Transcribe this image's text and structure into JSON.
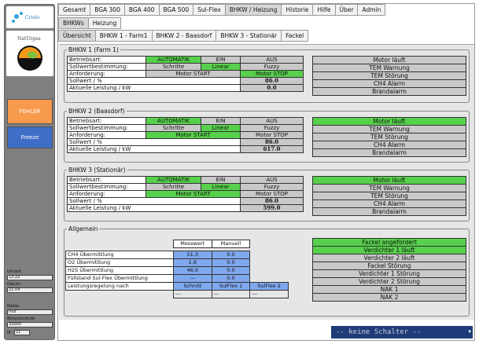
{
  "sidebar": {
    "logo_top": "Cristo",
    "logo_main": "NatUrgas",
    "fehler": "FEHLER",
    "freeze": "Freeze",
    "fields": [
      {
        "label": "Uhrzeit",
        "value": "13:22"
      },
      {
        "label": "Datum",
        "value": "21.04"
      },
      {
        "label": "Name:",
        "value": "mur"
      },
      {
        "label": "Benutzerstufe",
        "value": "32000"
      }
    ],
    "footer_label": "IP",
    "footer_value": "21"
  },
  "tabs_main": [
    "Gesamt",
    "BGA 300",
    "BGA 400",
    "BGA 500",
    "Sul-Flex",
    "BHKW / Heizung",
    "Historie",
    "Hilfe",
    "Über",
    "Admin"
  ],
  "tabs_sub": [
    "BHKWs",
    "Heizung"
  ],
  "tabs_sub2": [
    "Übersicht",
    "BHKW 1 - Farm1",
    "BHKW 2 - Baasdorf",
    "BHKW 3 - Stationär",
    "Fackel"
  ],
  "bhkw": [
    {
      "title": "BHKW 1 (Farm 1)",
      "betriebsart": "Betriebsart:",
      "auto": "AUTOMATIK",
      "ein": "EIN",
      "aus": "AUS",
      "soll_label": "Sollwertbestimmung:",
      "schritte": "Schritte",
      "linear": "Linear",
      "fuzzy": "Fuzzy",
      "anf_label": "Anforderung:",
      "start": "Motor START",
      "stop": "Motor STOP",
      "sollwert_label": "Sollwert / %",
      "sollwert": "86.0",
      "leistung_label": "Aktuelle Leistung / kW",
      "leistung": "0.0",
      "status": [
        "Motor läuft",
        "TEM Warnung",
        "TEM Störung",
        "CH4 Alarm",
        "Brandalarm"
      ],
      "auto_on": true,
      "linear_on": true,
      "start_on": false,
      "stop_on": true,
      "motor_on": false
    },
    {
      "title": "BHKW 2 (Baasdorf)",
      "betriebsart": "Betriebsart:",
      "auto": "AUTOMATIK",
      "ein": "EIN",
      "aus": "AUS",
      "soll_label": "Sollwertbestimmung:",
      "schritte": "Schritte",
      "linear": "Linear",
      "fuzzy": "Fuzzy",
      "anf_label": "Anforderung:",
      "start": "Motor START",
      "stop": "Motor STOP",
      "sollwert_label": "Sollwert / %",
      "sollwert": "86.0",
      "leistung_label": "Aktuelle Leistung / kW",
      "leistung": "617.0",
      "status": [
        "Motor läuft",
        "TEM Warnung",
        "TEM Störung",
        "CH4 Alarm",
        "Brandalarm"
      ],
      "auto_on": true,
      "linear_on": true,
      "start_on": true,
      "stop_on": false,
      "motor_on": true
    },
    {
      "title": "BHKW 3 (Stationär)",
      "betriebsart": "Betriebsart:",
      "auto": "AUTOMATIK",
      "ein": "EIN",
      "aus": "AUS",
      "soll_label": "Sollwertbestimmung:",
      "schritte": "Schritte",
      "linear": "Linear",
      "fuzzy": "Fuzzy",
      "anf_label": "Anforderung:",
      "start": "Motor START",
      "stop": "Motor STOP",
      "sollwert_label": "Sollwert / %",
      "sollwert": "86.0",
      "leistung_label": "Aktuelle Leistung / kW",
      "leistung": "599.0",
      "status": [
        "Motor läuft",
        "TEM Warnung",
        "TEM Störung",
        "CH4 Alarm",
        "Brandalarm"
      ],
      "auto_on": true,
      "linear_on": true,
      "start_on": true,
      "stop_on": false,
      "motor_on": true
    }
  ],
  "allgemein": {
    "title": "Allgemein",
    "col_mess": "Messwert",
    "col_manuell": "Manuell",
    "rows": [
      {
        "label": "CH4 Übermittlung",
        "mess": "51.3",
        "man": "0.0"
      },
      {
        "label": "O2 Übermittlung",
        "mess": "1.9",
        "man": "0.0"
      },
      {
        "label": "H2S Übermittlung",
        "mess": "46.0",
        "man": "0.0"
      },
      {
        "label": "Füllstand Sul-Flex Übermittlung",
        "mess": "---",
        "man": "0.0"
      }
    ],
    "regel_label": "Leistungsregelung nach",
    "regel": [
      "Schnitt",
      "SulFlex 1",
      "SulFlex 2"
    ],
    "dashes": [
      "---",
      "---",
      "---"
    ],
    "status": [
      "Fackel angefordert",
      "Verdichter 1 läuft",
      "Verdichter 2 läuft",
      "Fackel Störung",
      "Verdichter 1 Störung",
      "Verdichter 2 Störung",
      "NAK 1",
      "NAK 2"
    ],
    "status_on": [
      true,
      true,
      false,
      false,
      false,
      false,
      false,
      false
    ]
  },
  "selector": "-- keine Schalter --",
  "colors": {
    "active_green": "#57d04c",
    "inactive_grey": "#c9c9c9",
    "blue": "#7fa8ee",
    "fehler_orange": "#f79a4c",
    "freeze_blue": "#3f6ec8"
  }
}
